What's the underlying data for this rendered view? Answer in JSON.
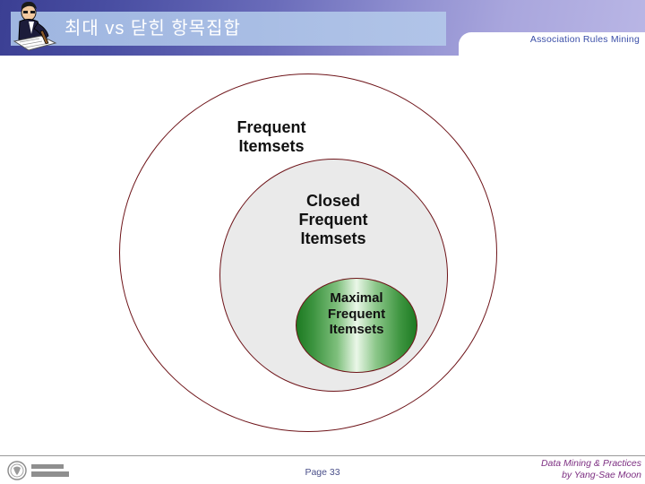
{
  "header": {
    "title": "최대 vs 닫힌 항목집합",
    "subtitle": "Association Rules Mining",
    "clipart_name": "presenter-clipart-icon",
    "accent_color": "#3b3f93",
    "plate_color": "#a8bde4",
    "subtitle_color": "#3b4fa8"
  },
  "diagram": {
    "type": "venn-nested",
    "outer": {
      "label_line1": "Frequent",
      "label_line2": "Itemsets",
      "fill": "#ffffff",
      "stroke": "#6e1419"
    },
    "middle": {
      "label_line1": "Closed",
      "label_line2": "Frequent",
      "label_line3": "Itemsets",
      "fill": "#eaeaea",
      "stroke": "#6e1419"
    },
    "inner": {
      "label_line1": "Maximal",
      "label_line2": "Frequent",
      "label_line3": "Itemsets",
      "fill": "#2e8b33",
      "stroke": "#6e1419"
    }
  },
  "footer": {
    "logo_name": "kangwon-university-logo",
    "page_label": "Page 33",
    "credit_line1": "Data Mining & Practices",
    "credit_line2": "by Yang-Sae Moon",
    "credit_color": "#7d2f82",
    "page_color": "#4a4f8a"
  }
}
